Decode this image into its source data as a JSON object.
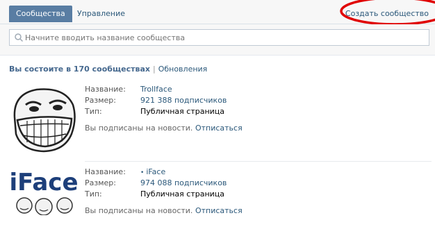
{
  "tabs": [
    {
      "label": "Сообщества",
      "active": true
    },
    {
      "label": "Управление",
      "active": false
    }
  ],
  "create_link": "Создать сообщество",
  "search": {
    "placeholder": "Начните вводить название сообщества",
    "value": ""
  },
  "summary": {
    "prefix": "Вы состоите в ",
    "count": "170 сообществах",
    "separator": "|",
    "updates": "Обновления"
  },
  "groups": [
    {
      "name_label": "Название:",
      "name": "Trollface",
      "size_label": "Размер:",
      "size": "921 388 подписчиков",
      "type_label": "Тип:",
      "type": "Публичная страница",
      "subscribed": "Вы подписаны на новости.",
      "unsubscribe": "Отписаться",
      "avatar": "trollface"
    },
    {
      "name_label": "Название:",
      "name": "iFace",
      "bullet": "•",
      "size_label": "Размер:",
      "size": "974 088 подписчиков",
      "type_label": "Тип:",
      "type": "Публичная страница",
      "subscribed": "Вы подписаны на новости.",
      "unsubscribe": "Отписаться",
      "avatar": "iface",
      "avatar_text": "iFace"
    }
  ],
  "colors": {
    "accent": "#597da3",
    "link": "#2b587a",
    "annotation": "#e00000"
  }
}
